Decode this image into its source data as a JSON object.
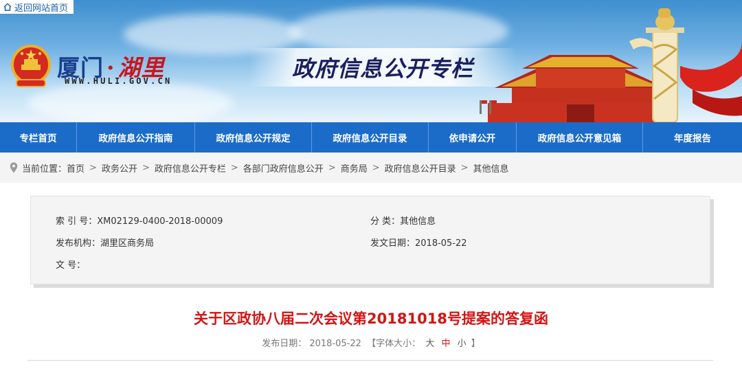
{
  "top_link": {
    "label": "返回网站首页",
    "icon": "home-icon"
  },
  "logo": {
    "name_part1": "厦门",
    "separator": "·",
    "name_part2": "湖里",
    "url": "WWW.HULI.GOV.CN"
  },
  "banner_title": "政府信息公开专栏",
  "nav": {
    "items": [
      {
        "label": "专栏首页"
      },
      {
        "label": "政府信息公开指南"
      },
      {
        "label": "政府信息公开规定"
      },
      {
        "label": "政府信息公开目录"
      },
      {
        "label": "依申请公开"
      },
      {
        "label": "政府信息公开意见箱"
      },
      {
        "label": "年度报告"
      }
    ]
  },
  "breadcrumb": {
    "prefix": "当前位置：",
    "separator": ">",
    "items": [
      "首页",
      "政务公开",
      "政府信息公开专栏",
      "各部门政府信息公开",
      "商务局",
      "政府信息公开目录",
      "其他信息"
    ]
  },
  "info": {
    "index_no": "索 引 号：XM02129-0400-2018-00009",
    "category": "分 类：其他信息",
    "publisher": "发布机构：湖里区商务局",
    "issue_date": "发文日期：2018-05-22",
    "doc_no": "文 号："
  },
  "article": {
    "title": "关于区政协八届二次会议第20181018号提案的答复函",
    "publish_label": "发布日期：",
    "publish_date": "2018-05-22",
    "font_size_label": "【字体大小：",
    "font_large": "大",
    "font_medium": "中",
    "font_small": "小",
    "font_size_close": "】"
  },
  "colors": {
    "nav_bg": "#1b6cc8",
    "title_red": "#d21414",
    "logo_blue": "#1a3f8c"
  }
}
